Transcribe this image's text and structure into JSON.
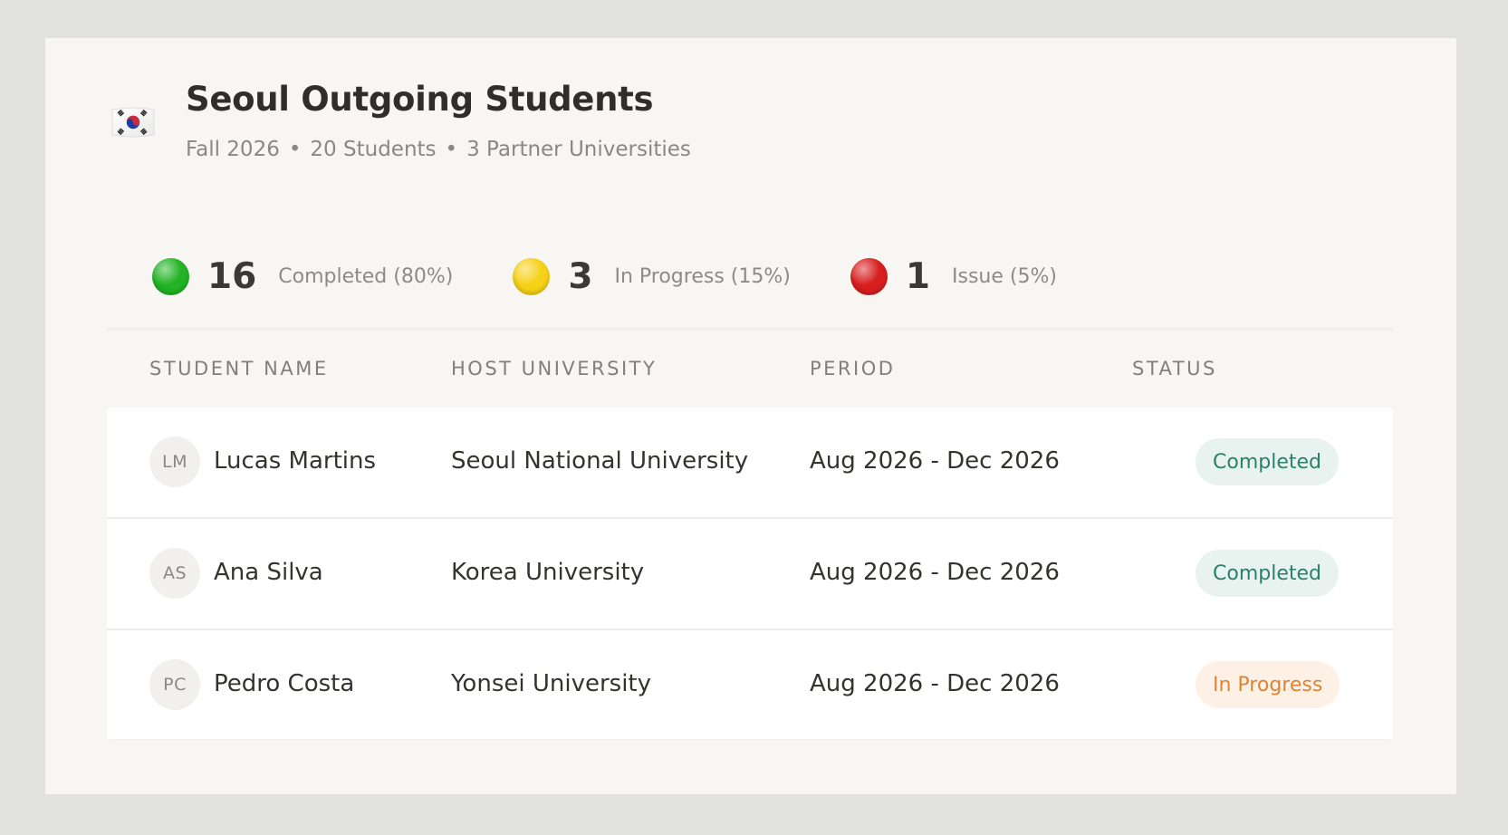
{
  "header": {
    "title": "Seoul Outgoing Students",
    "subtitle_parts": [
      "Fall 2026",
      "20 Students",
      "3 Partner Universities"
    ],
    "separator": "•",
    "flag_icon": "south-korea-flag-icon"
  },
  "stats": [
    {
      "count": "16",
      "label": "Completed (80%)",
      "color": "#22b324"
    },
    {
      "count": "3",
      "label": "In Progress (15%)",
      "color": "#f6d117"
    },
    {
      "count": "1",
      "label": "Issue (5%)",
      "color": "#d81e1e"
    }
  ],
  "table": {
    "columns": [
      "STUDENT NAME",
      "HOST UNIVERSITY",
      "PERIOD",
      "STATUS"
    ],
    "rows": [
      {
        "initials": "LM",
        "name": "Lucas Martins",
        "university": "Seoul National University",
        "period": "Aug 2026 - Dec 2026",
        "status": "Completed",
        "status_kind": "completed"
      },
      {
        "initials": "AS",
        "name": "Ana Silva",
        "university": "Korea University",
        "period": "Aug 2026 - Dec 2026",
        "status": "Completed",
        "status_kind": "completed"
      },
      {
        "initials": "PC",
        "name": "Pedro Costa",
        "university": "Yonsei University",
        "period": "Aug 2026 - Dec 2026",
        "status": "In Progress",
        "status_kind": "progress"
      }
    ]
  },
  "colors": {
    "completed_text": "#2b8067",
    "completed_bg": "#e8f3f0",
    "progress_text": "#dd8437",
    "progress_bg": "#fdf1e6"
  }
}
